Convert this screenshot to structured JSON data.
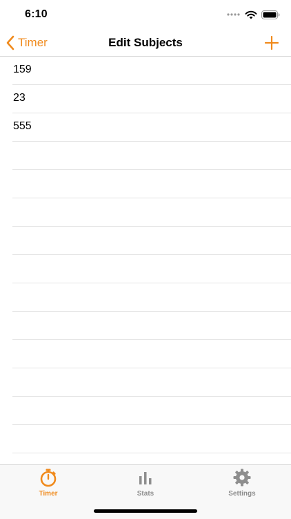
{
  "status_bar": {
    "time": "6:10"
  },
  "nav": {
    "back_label": "Timer",
    "title": "Edit Subjects"
  },
  "subjects": [
    "159",
    "23",
    "555",
    "",
    "",
    "",
    "",
    "",
    "",
    "",
    "",
    "",
    "",
    "",
    ""
  ],
  "tabs": [
    {
      "label": "Timer",
      "icon": "stopwatch-icon",
      "active": true
    },
    {
      "label": "Stats",
      "icon": "bar-chart-icon",
      "active": false
    },
    {
      "label": "Settings",
      "icon": "gear-icon",
      "active": false
    }
  ],
  "colors": {
    "accent": "#f08a1c",
    "inactive": "#8e8e8e"
  }
}
